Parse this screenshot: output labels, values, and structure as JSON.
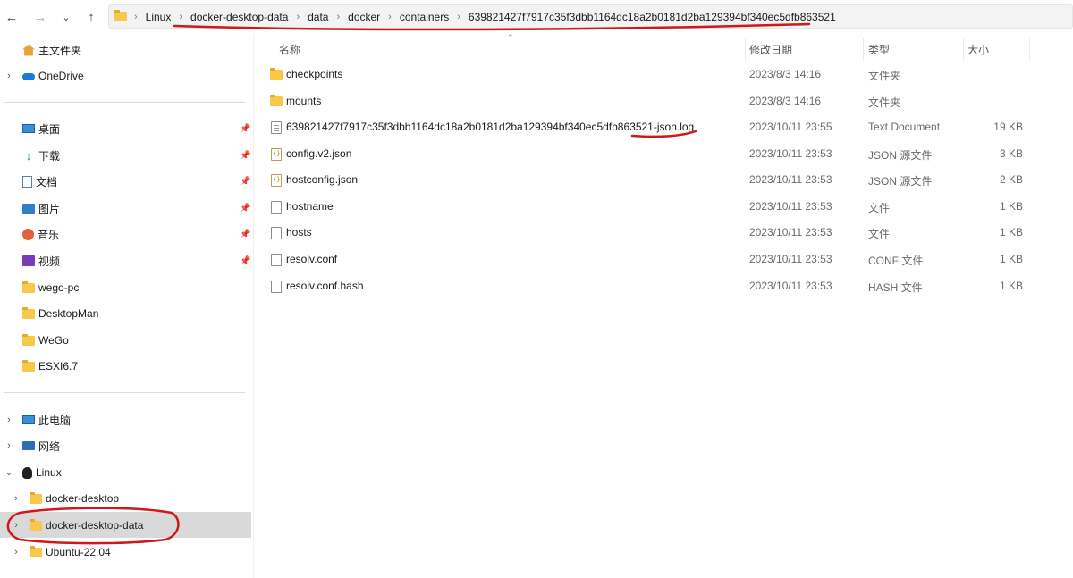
{
  "nav": {
    "back_icon": "arrow-left-icon",
    "forward_icon": "arrow-right-icon",
    "recent_icon": "chevron-down-icon",
    "up_icon": "arrow-up-icon"
  },
  "breadcrumb": [
    "Linux",
    "docker-desktop-data",
    "data",
    "docker",
    "containers",
    "639821427f7917c35f3dbb1164dc18a2b0181d2ba129394bf340ec5dfb863521"
  ],
  "sidebar": {
    "home": "主文件夹",
    "onedrive": "OneDrive",
    "quick": [
      {
        "label": "桌面",
        "icon": "desktop-icon"
      },
      {
        "label": "下载",
        "icon": "download-icon"
      },
      {
        "label": "文档",
        "icon": "document-icon"
      },
      {
        "label": "图片",
        "icon": "picture-icon"
      },
      {
        "label": "音乐",
        "icon": "music-icon"
      },
      {
        "label": "视频",
        "icon": "video-icon"
      }
    ],
    "folders": [
      "wego-pc",
      "DesktopMan",
      "WeGo",
      "ESXI6.7"
    ],
    "pc": "此电脑",
    "network": "网络",
    "linux": "Linux",
    "linux_children": [
      "docker-desktop",
      "docker-desktop-data",
      "Ubuntu-22.04"
    ]
  },
  "columns": {
    "name": "名称",
    "date": "修改日期",
    "type": "类型",
    "size": "大小"
  },
  "files": [
    {
      "name": "checkpoints",
      "date": "2023/8/3 14:16",
      "type": "文件夹",
      "size": "",
      "icon": "folder-icon"
    },
    {
      "name": "mounts",
      "date": "2023/8/3 14:16",
      "type": "文件夹",
      "size": "",
      "icon": "folder-icon"
    },
    {
      "name": "639821427f7917c35f3dbb1164dc18a2b0181d2ba129394bf340ec5dfb863521-json.log",
      "date": "2023/10/11 23:55",
      "type": "Text Document",
      "size": "19 KB",
      "icon": "text-file-icon"
    },
    {
      "name": "config.v2.json",
      "date": "2023/10/11 23:53",
      "type": "JSON 源文件",
      "size": "3 KB",
      "icon": "json-file-icon"
    },
    {
      "name": "hostconfig.json",
      "date": "2023/10/11 23:53",
      "type": "JSON 源文件",
      "size": "2 KB",
      "icon": "json-file-icon"
    },
    {
      "name": "hostname",
      "date": "2023/10/11 23:53",
      "type": "文件",
      "size": "1 KB",
      "icon": "file-icon"
    },
    {
      "name": "hosts",
      "date": "2023/10/11 23:53",
      "type": "文件",
      "size": "1 KB",
      "icon": "file-icon"
    },
    {
      "name": "resolv.conf",
      "date": "2023/10/11 23:53",
      "type": "CONF 文件",
      "size": "1 KB",
      "icon": "file-icon"
    },
    {
      "name": "resolv.conf.hash",
      "date": "2023/10/11 23:53",
      "type": "HASH 文件",
      "size": "1 KB",
      "icon": "file-icon"
    }
  ],
  "colors": {
    "annotation": "#d01818",
    "folder": "#f8c84a",
    "selection": "#d9d9d9"
  }
}
